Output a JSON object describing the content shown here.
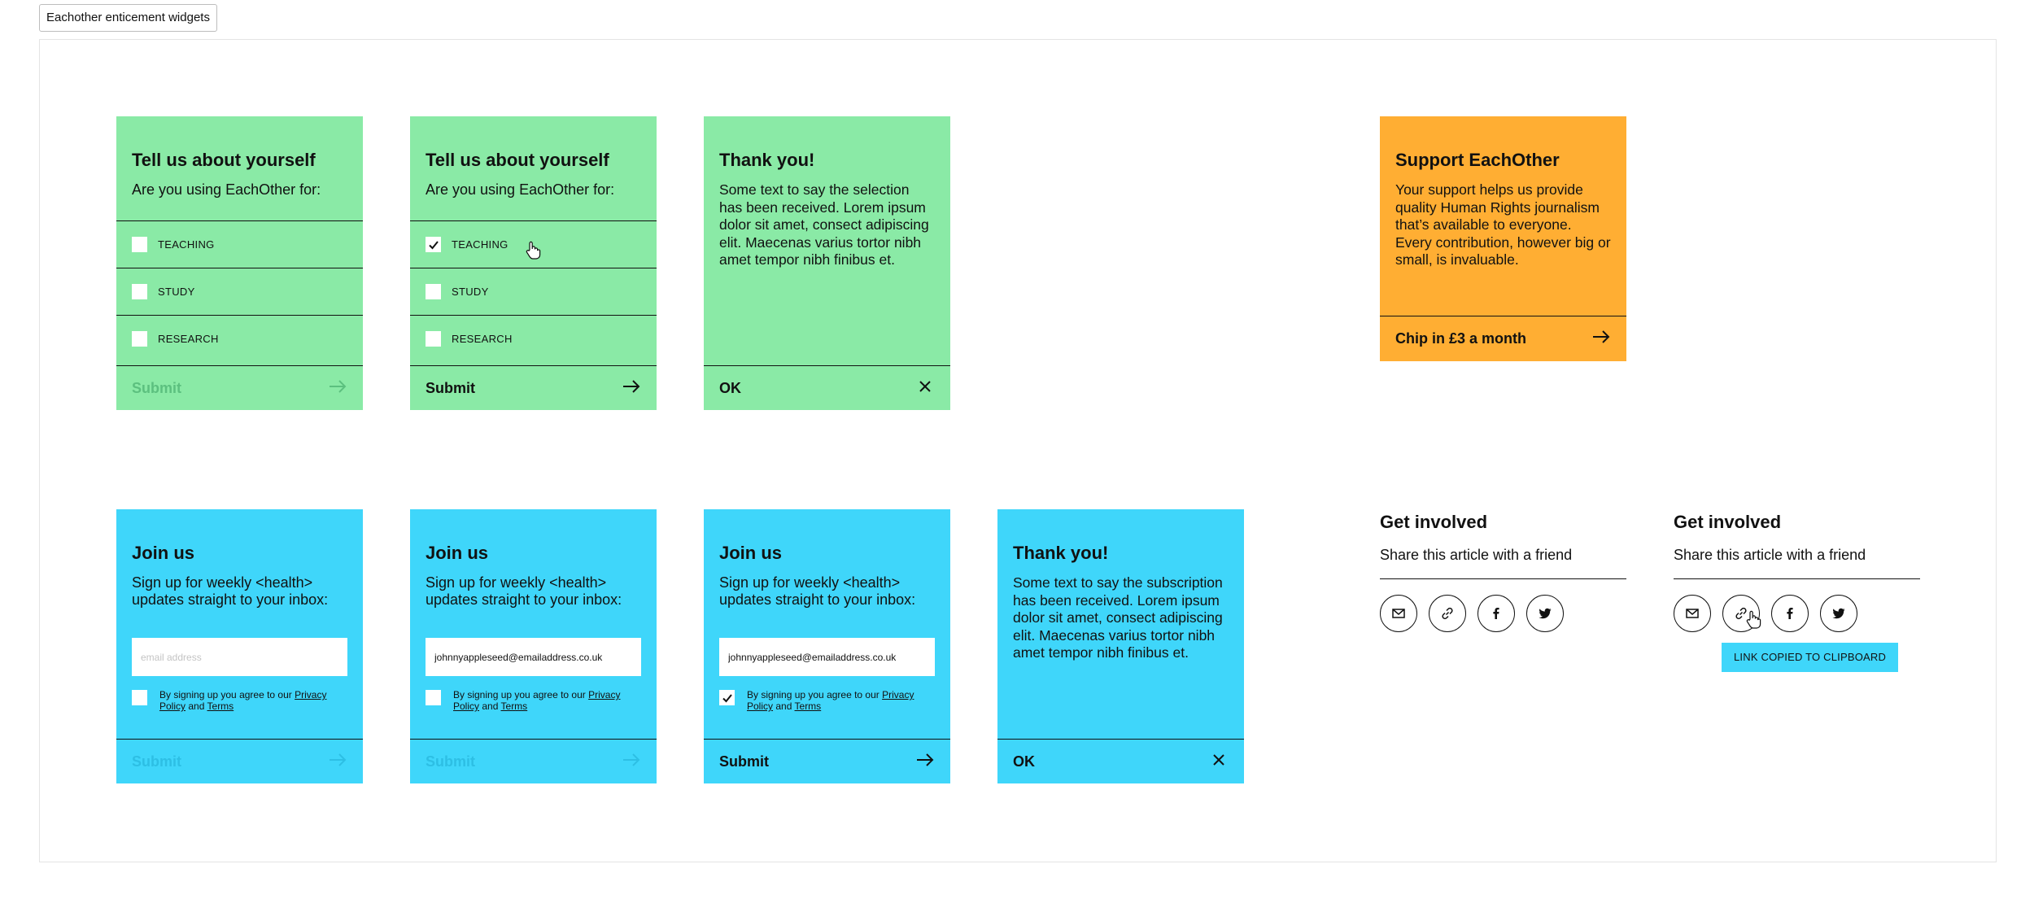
{
  "story_label": "Eachother enticement widgets",
  "survey": {
    "title": "Tell us about yourself",
    "question": "Are you using EachOther for:",
    "options": [
      "TEACHING",
      "STUDY",
      "RESEARCH"
    ],
    "submit_label": "Submit"
  },
  "survey_thanks": {
    "title": "Thank you!",
    "body": "Some text to say the selection has been received. Lorem ipsum dolor sit amet, consect adipiscing elit. Maecenas varius tortor nibh amet tempor nibh finibus et.",
    "ok_label": "OK"
  },
  "support": {
    "title": "Support EachOther",
    "body": "Your support helps us provide quality Human Rights journalism that’s available to everyone. Every contribution, however big or small, is invaluable.",
    "cta_label": "Chip in £3 a month"
  },
  "signup": {
    "title": "Join us",
    "body": "Sign up for weekly <health> updates straight to your inbox:",
    "email_placeholder": "email address",
    "email_value": "johnnyappleseed@emailaddress.co.uk",
    "consent_prefix": "By signing up you agree to our",
    "privacy_link": "Privacy Policy",
    "consent_and": "and",
    "terms_link": "Terms",
    "submit_label": "Submit"
  },
  "signup_thanks": {
    "title": "Thank you!",
    "body": "Some text to say the subscription has been received. Lorem ipsum dolor sit amet, consect adipiscing elit. Maecenas varius tortor nibh amet tempor nibh finibus et.",
    "ok_label": "OK"
  },
  "share": {
    "title": "Get involved",
    "subtitle": "Share this article with a friend",
    "icons": [
      "email-icon",
      "link-icon",
      "facebook-icon",
      "twitter-icon"
    ],
    "tooltip": "LINK COPIED TO CLIPBOARD"
  },
  "colors": {
    "green": "#8aeaa6",
    "blue": "#3fd6fa",
    "orange": "#ffae33",
    "ink": "#111111"
  }
}
